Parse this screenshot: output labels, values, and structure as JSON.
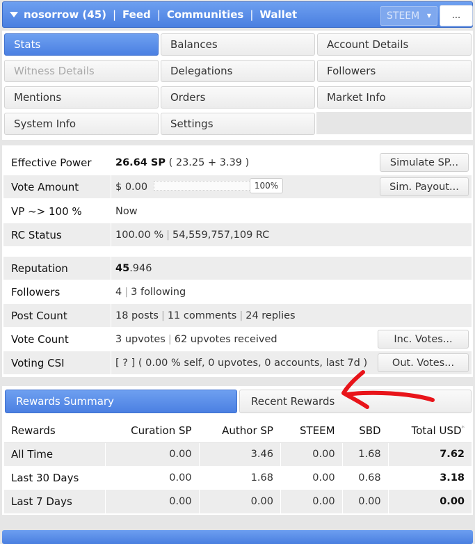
{
  "header": {
    "account": "nosorrow (45)",
    "links": [
      "Feed",
      "Communities",
      "Wallet"
    ],
    "separator": "|",
    "currency": "STEEM",
    "more_label": "..."
  },
  "tabs": [
    {
      "label": "Stats",
      "state": "active"
    },
    {
      "label": "Balances",
      "state": "normal"
    },
    {
      "label": "Account Details",
      "state": "normal"
    },
    {
      "label": "Witness Details",
      "state": "disabled"
    },
    {
      "label": "Delegations",
      "state": "normal"
    },
    {
      "label": "Followers",
      "state": "normal"
    },
    {
      "label": "Mentions",
      "state": "normal"
    },
    {
      "label": "Orders",
      "state": "normal"
    },
    {
      "label": "Market Info",
      "state": "normal"
    },
    {
      "label": "System Info",
      "state": "normal"
    },
    {
      "label": "Settings",
      "state": "normal"
    }
  ],
  "stats": {
    "effective_power": {
      "label": "Effective Power",
      "value": "26.64 SP",
      "detail": "( 23.25 + 3.39 )",
      "button": "Simulate SP..."
    },
    "vote_amount": {
      "label": "Vote Amount",
      "value": "$ 0.00",
      "slider_label": "100%",
      "slider_percent": 100,
      "button": "Sim. Payout..."
    },
    "vp": {
      "label": "VP ~> 100 %",
      "value": "Now"
    },
    "rc": {
      "label": "RC Status",
      "value": "100.00 %",
      "detail": "54,559,757,109 RC"
    },
    "reputation": {
      "label": "Reputation",
      "value_int": "45",
      "value_dec": ".946"
    },
    "followers": {
      "label": "Followers",
      "value": "4",
      "detail": "3 following"
    },
    "post_count": {
      "label": "Post Count",
      "posts": "18 posts",
      "comments": "11 comments",
      "replies": "24 replies"
    },
    "vote_count": {
      "label": "Vote Count",
      "value": "3 upvotes",
      "detail": "62 upvotes received",
      "button": "Inc. Votes..."
    },
    "voting_csi": {
      "label": "Voting CSI",
      "value": "[ ? ] ( 0.00 % self, 0 upvotes, 0 accounts, last 7d )",
      "button": "Out. Votes..."
    }
  },
  "rewards": {
    "tabs": [
      "Rewards Summary",
      "Recent Rewards"
    ],
    "columns": [
      "Rewards",
      "Curation SP",
      "Author SP",
      "STEEM",
      "SBD",
      "Total USD"
    ],
    "total_marker": "*",
    "rows": [
      [
        "All Time",
        "0.00",
        "3.46",
        "0.00",
        "1.68",
        "7.62"
      ],
      [
        "Last 30 Days",
        "0.00",
        "1.68",
        "0.00",
        "0.68",
        "3.18"
      ],
      [
        "Last 7 Days",
        "0.00",
        "0.00",
        "0.00",
        "0.00",
        "0.00"
      ]
    ]
  },
  "colors": {
    "accent": "#4b80e2",
    "annotation": "#e8141a"
  }
}
